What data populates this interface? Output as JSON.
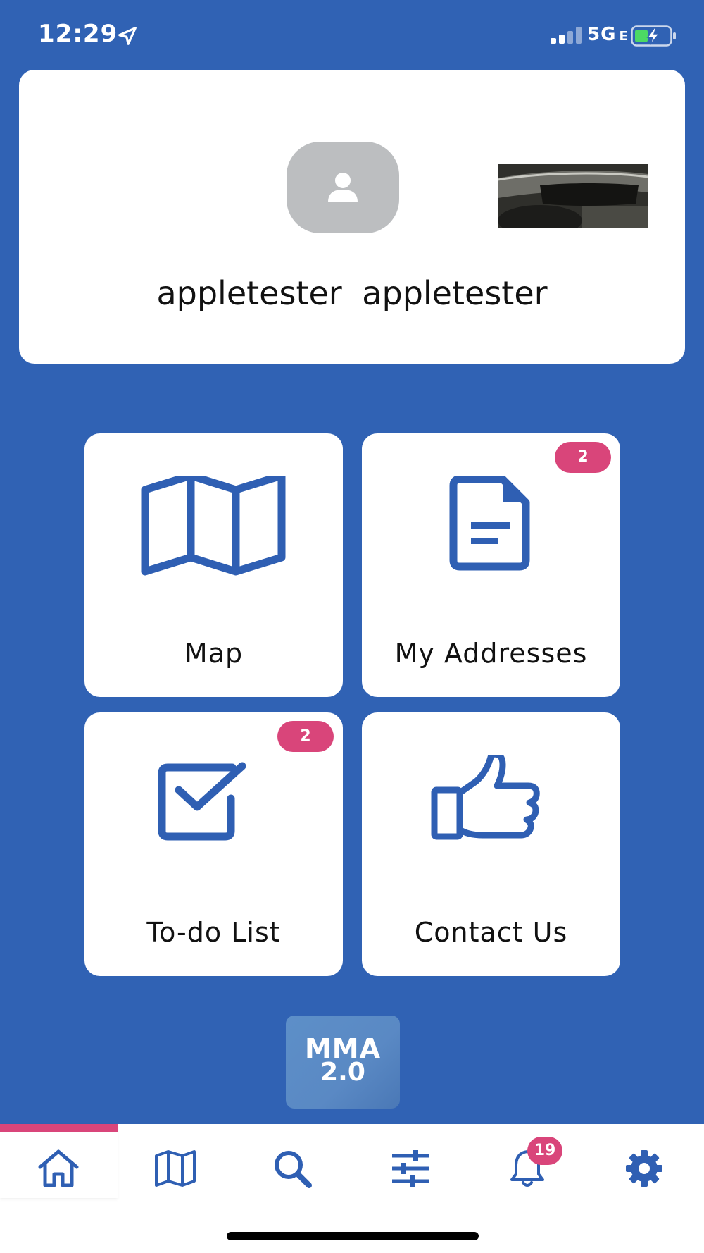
{
  "status_bar": {
    "time": "12:29",
    "network": "5G",
    "network_suffix": "E"
  },
  "profile": {
    "name": "appletester  appletester"
  },
  "tiles": [
    {
      "label": "Map",
      "icon": "folded-map-icon",
      "badge": ""
    },
    {
      "label": "My Addresses",
      "icon": "document-icon",
      "badge": "2"
    },
    {
      "label": "To-do List",
      "icon": "checkbox-check-icon",
      "badge": "2"
    },
    {
      "label": "Contact Us",
      "icon": "thumbs-up-icon",
      "badge": ""
    }
  ],
  "logo": {
    "line1": "MMA",
    "line2": "2.0"
  },
  "tab_bar": {
    "items": [
      {
        "name": "home",
        "icon": "home-icon"
      },
      {
        "name": "map",
        "icon": "map-icon"
      },
      {
        "name": "search",
        "icon": "search-icon"
      },
      {
        "name": "filters",
        "icon": "sliders-icon"
      },
      {
        "name": "notifications",
        "icon": "bell-icon",
        "badge": "19"
      },
      {
        "name": "settings",
        "icon": "gear-icon"
      }
    ],
    "active": "home"
  },
  "colors": {
    "background": "#3062b4",
    "accent_blue": "#2f5fb3",
    "badge_pink": "#d9457a",
    "card_white": "#ffffff"
  }
}
